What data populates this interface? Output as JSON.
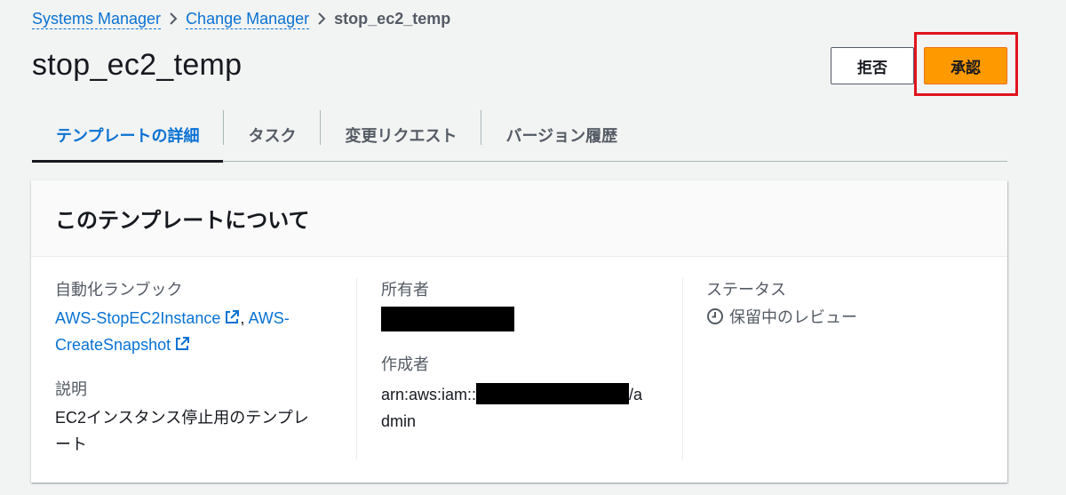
{
  "breadcrumb": {
    "items": [
      "Systems Manager",
      "Change Manager"
    ],
    "current": "stop_ec2_temp"
  },
  "page": {
    "title": "stop_ec2_temp"
  },
  "actions": {
    "reject_label": "拒否",
    "approve_label": "承認"
  },
  "tabs": [
    {
      "label": "テンプレートの詳細",
      "active": true
    },
    {
      "label": "タスク",
      "active": false
    },
    {
      "label": "変更リクエスト",
      "active": false
    },
    {
      "label": "バージョン履歴",
      "active": false
    }
  ],
  "panel": {
    "title": "このテンプレートについて",
    "runbook_label": "自動化ランブック",
    "runbook_link_1": "AWS-StopEC2Instance",
    "runbook_sep": ", ",
    "runbook_link_2a": "AWS-",
    "runbook_link_2b": "CreateSnapshot",
    "description_label": "説明",
    "description_line1": "EC2インスタンス停止用のテンプレ",
    "description_line2": "ート",
    "owner_label": "所有者",
    "creator_label": "作成者",
    "creator_prefix": "arn:aws:iam::",
    "creator_suffix": "/a",
    "creator_line2": "dmin",
    "status_label": "ステータス",
    "status_value": "保留中のレビュー"
  },
  "colors": {
    "link": "#0972d3",
    "primary_button": "#ff9900",
    "highlight": "#e0141e"
  }
}
